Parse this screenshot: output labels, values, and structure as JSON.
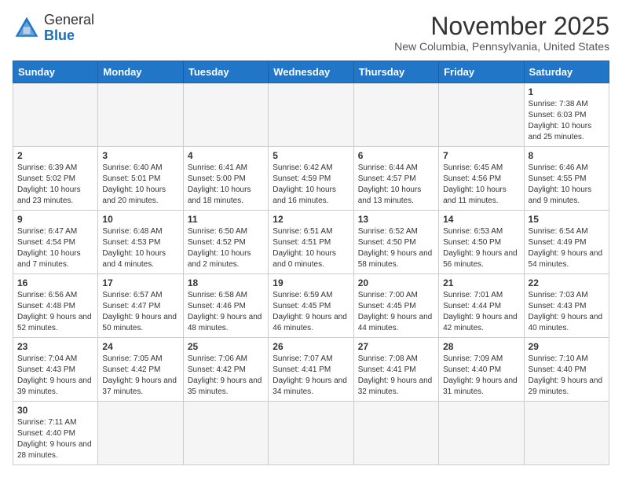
{
  "header": {
    "logo_general": "General",
    "logo_blue": "Blue",
    "month_title": "November 2025",
    "location": "New Columbia, Pennsylvania, United States"
  },
  "weekdays": [
    "Sunday",
    "Monday",
    "Tuesday",
    "Wednesday",
    "Thursday",
    "Friday",
    "Saturday"
  ],
  "weeks": [
    [
      {
        "day": "",
        "info": ""
      },
      {
        "day": "",
        "info": ""
      },
      {
        "day": "",
        "info": ""
      },
      {
        "day": "",
        "info": ""
      },
      {
        "day": "",
        "info": ""
      },
      {
        "day": "",
        "info": ""
      },
      {
        "day": "1",
        "info": "Sunrise: 7:38 AM\nSunset: 6:03 PM\nDaylight: 10 hours and 25 minutes."
      }
    ],
    [
      {
        "day": "2",
        "info": "Sunrise: 6:39 AM\nSunset: 5:02 PM\nDaylight: 10 hours and 23 minutes."
      },
      {
        "day": "3",
        "info": "Sunrise: 6:40 AM\nSunset: 5:01 PM\nDaylight: 10 hours and 20 minutes."
      },
      {
        "day": "4",
        "info": "Sunrise: 6:41 AM\nSunset: 5:00 PM\nDaylight: 10 hours and 18 minutes."
      },
      {
        "day": "5",
        "info": "Sunrise: 6:42 AM\nSunset: 4:59 PM\nDaylight: 10 hours and 16 minutes."
      },
      {
        "day": "6",
        "info": "Sunrise: 6:44 AM\nSunset: 4:57 PM\nDaylight: 10 hours and 13 minutes."
      },
      {
        "day": "7",
        "info": "Sunrise: 6:45 AM\nSunset: 4:56 PM\nDaylight: 10 hours and 11 minutes."
      },
      {
        "day": "8",
        "info": "Sunrise: 6:46 AM\nSunset: 4:55 PM\nDaylight: 10 hours and 9 minutes."
      }
    ],
    [
      {
        "day": "9",
        "info": "Sunrise: 6:47 AM\nSunset: 4:54 PM\nDaylight: 10 hours and 7 minutes."
      },
      {
        "day": "10",
        "info": "Sunrise: 6:48 AM\nSunset: 4:53 PM\nDaylight: 10 hours and 4 minutes."
      },
      {
        "day": "11",
        "info": "Sunrise: 6:50 AM\nSunset: 4:52 PM\nDaylight: 10 hours and 2 minutes."
      },
      {
        "day": "12",
        "info": "Sunrise: 6:51 AM\nSunset: 4:51 PM\nDaylight: 10 hours and 0 minutes."
      },
      {
        "day": "13",
        "info": "Sunrise: 6:52 AM\nSunset: 4:50 PM\nDaylight: 9 hours and 58 minutes."
      },
      {
        "day": "14",
        "info": "Sunrise: 6:53 AM\nSunset: 4:50 PM\nDaylight: 9 hours and 56 minutes."
      },
      {
        "day": "15",
        "info": "Sunrise: 6:54 AM\nSunset: 4:49 PM\nDaylight: 9 hours and 54 minutes."
      }
    ],
    [
      {
        "day": "16",
        "info": "Sunrise: 6:56 AM\nSunset: 4:48 PM\nDaylight: 9 hours and 52 minutes."
      },
      {
        "day": "17",
        "info": "Sunrise: 6:57 AM\nSunset: 4:47 PM\nDaylight: 9 hours and 50 minutes."
      },
      {
        "day": "18",
        "info": "Sunrise: 6:58 AM\nSunset: 4:46 PM\nDaylight: 9 hours and 48 minutes."
      },
      {
        "day": "19",
        "info": "Sunrise: 6:59 AM\nSunset: 4:45 PM\nDaylight: 9 hours and 46 minutes."
      },
      {
        "day": "20",
        "info": "Sunrise: 7:00 AM\nSunset: 4:45 PM\nDaylight: 9 hours and 44 minutes."
      },
      {
        "day": "21",
        "info": "Sunrise: 7:01 AM\nSunset: 4:44 PM\nDaylight: 9 hours and 42 minutes."
      },
      {
        "day": "22",
        "info": "Sunrise: 7:03 AM\nSunset: 4:43 PM\nDaylight: 9 hours and 40 minutes."
      }
    ],
    [
      {
        "day": "23",
        "info": "Sunrise: 7:04 AM\nSunset: 4:43 PM\nDaylight: 9 hours and 39 minutes."
      },
      {
        "day": "24",
        "info": "Sunrise: 7:05 AM\nSunset: 4:42 PM\nDaylight: 9 hours and 37 minutes."
      },
      {
        "day": "25",
        "info": "Sunrise: 7:06 AM\nSunset: 4:42 PM\nDaylight: 9 hours and 35 minutes."
      },
      {
        "day": "26",
        "info": "Sunrise: 7:07 AM\nSunset: 4:41 PM\nDaylight: 9 hours and 34 minutes."
      },
      {
        "day": "27",
        "info": "Sunrise: 7:08 AM\nSunset: 4:41 PM\nDaylight: 9 hours and 32 minutes."
      },
      {
        "day": "28",
        "info": "Sunrise: 7:09 AM\nSunset: 4:40 PM\nDaylight: 9 hours and 31 minutes."
      },
      {
        "day": "29",
        "info": "Sunrise: 7:10 AM\nSunset: 4:40 PM\nDaylight: 9 hours and 29 minutes."
      }
    ],
    [
      {
        "day": "30",
        "info": "Sunrise: 7:11 AM\nSunset: 4:40 PM\nDaylight: 9 hours and 28 minutes."
      },
      {
        "day": "",
        "info": ""
      },
      {
        "day": "",
        "info": ""
      },
      {
        "day": "",
        "info": ""
      },
      {
        "day": "",
        "info": ""
      },
      {
        "day": "",
        "info": ""
      },
      {
        "day": "",
        "info": ""
      }
    ]
  ]
}
